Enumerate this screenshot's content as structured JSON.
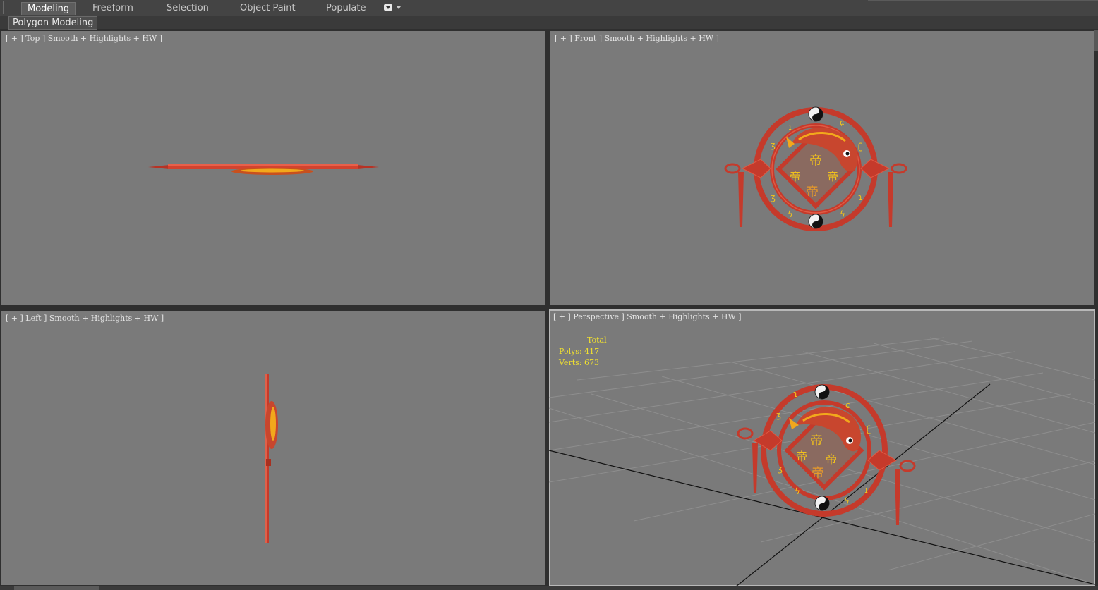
{
  "ribbon": {
    "tabs": [
      {
        "label": "Modeling",
        "active": true
      },
      {
        "label": "Freeform",
        "active": false
      },
      {
        "label": "Selection",
        "active": false
      },
      {
        "label": "Object Paint",
        "active": false
      },
      {
        "label": "Populate",
        "active": false
      }
    ],
    "panel_label": "Polygon Modeling"
  },
  "viewports": {
    "top": {
      "label": "[ + ] Top ] Smooth + Highlights + HW ]"
    },
    "front": {
      "label": "[ + ] Front ] Smooth + Highlights + HW ]"
    },
    "left": {
      "label": "[ + ] Left ] Smooth + Highlights + HW ]"
    },
    "perspective": {
      "label": "[ + ] Perspective ] Smooth + Highlights + HW ]",
      "stats": {
        "title": "Total",
        "polys": "Polys: 417",
        "verts": "Verts: 673"
      }
    }
  },
  "colors": {
    "viewport_bg": "#7a7a7a",
    "model_red": "#c4382a",
    "glyph_gold": "#f2c21c",
    "stats_yellow": "#f0e030"
  },
  "icons": [
    "tab-menu-icon",
    "dropdown-arrow-icon",
    "yin-yang-icon"
  ]
}
